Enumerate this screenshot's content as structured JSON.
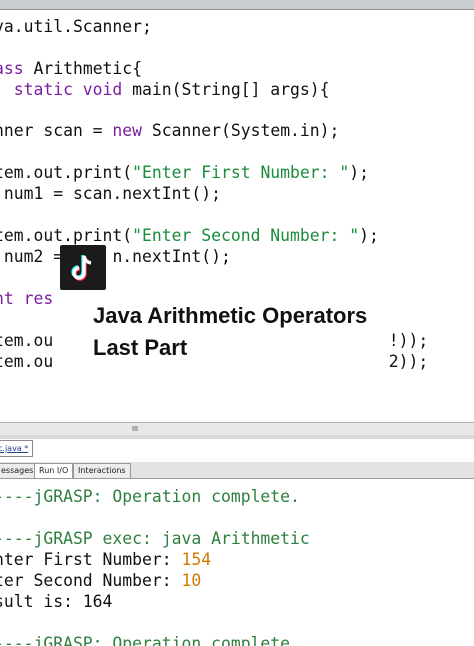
{
  "editor": {
    "lines": [
      {
        "segments": [
          {
            "text": "va.util.Scanner;",
            "cls": "plain"
          }
        ]
      },
      {
        "segments": [
          {
            "text": "ass ",
            "cls": "kw"
          },
          {
            "text": "Arithmetic{",
            "cls": "plain"
          }
        ]
      },
      {
        "segments": [
          {
            "text": "  static void ",
            "cls": "kw"
          },
          {
            "text": "main(String[] args){",
            "cls": "plain"
          }
        ]
      },
      {
        "segments": [
          {
            "text": "nner scan = ",
            "cls": "plain"
          },
          {
            "text": "new ",
            "cls": "kw"
          },
          {
            "text": "Scanner(System.in);",
            "cls": "plain"
          }
        ]
      },
      {
        "segments": [
          {
            "text": "tem.out.print(",
            "cls": "plain"
          },
          {
            "text": "\"Enter First Number: \"",
            "cls": "str"
          },
          {
            "text": ");",
            "cls": "plain"
          }
        ]
      },
      {
        "segments": [
          {
            "text": " num1 = scan.nextInt();",
            "cls": "plain"
          }
        ]
      },
      {
        "segments": [
          {
            "text": "tem.out.print(",
            "cls": "plain"
          },
          {
            "text": "\"Enter Second Number: \"",
            "cls": "str"
          },
          {
            "text": ");",
            "cls": "plain"
          }
        ]
      },
      {
        "segments": [
          {
            "text": " num2 = ",
            "cls": "plain"
          },
          {
            "text": "    ",
            "cls": "plain"
          },
          {
            "text": "n.nextInt();",
            "cls": "plain"
          }
        ]
      },
      {
        "segments": [
          {
            "text": "nt res",
            "cls": "kw"
          }
        ]
      },
      {
        "segments": [
          {
            "text": "tem.ou",
            "cls": "plain"
          },
          {
            "text": "                                  ",
            "cls": "plain"
          },
          {
            "text": "!));",
            "cls": "plain"
          }
        ]
      },
      {
        "segments": [
          {
            "text": "tem.ou",
            "cls": "plain"
          },
          {
            "text": "                                  ",
            "cls": "plain"
          },
          {
            "text": "2));",
            "cls": "plain"
          }
        ]
      }
    ]
  },
  "file_tab": {
    "label": "c.java *"
  },
  "panel_tabs": [
    {
      "label": "essages",
      "active": false
    },
    {
      "label": "Run I/O",
      "active": true
    },
    {
      "label": "Interactions",
      "active": false
    }
  ],
  "output": {
    "line1": "----jGRASP: Operation complete.",
    "line2": "----jGRASP exec: java Arithmetic",
    "line3_label": "nter First Number: ",
    "line3_value": "154",
    "line4_label": "ter Second Number: ",
    "line4_value": "10",
    "line5": "sult is: 164",
    "line6": "----jGRASP: Operation complete"
  },
  "overlay": {
    "line1": "Java Arithmetic Operators",
    "line2": "Last Part"
  },
  "icons": {
    "logo": "tiktok-icon",
    "grip": "grip-icon"
  },
  "colors": {
    "keyword": "#7a1fa2",
    "string": "#1a8c3a",
    "system_output": "#2f7f3f",
    "input_value": "#d27a00"
  }
}
